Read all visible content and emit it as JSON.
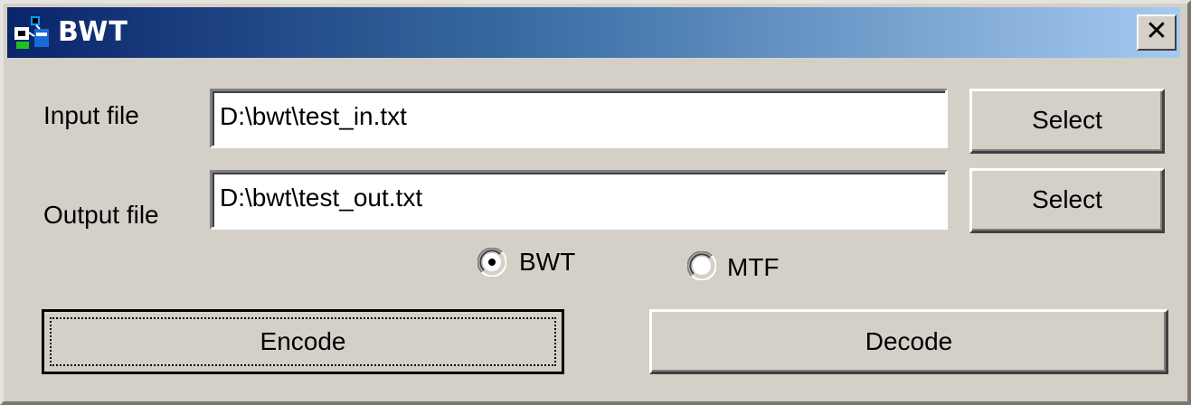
{
  "window": {
    "title": "BWT",
    "close_label": "✕"
  },
  "form": {
    "input_label": "Input file",
    "input_value": "D:\\bwt\\test_in.txt",
    "input_select_label": "Select",
    "output_label": "Output file",
    "output_value": "D:\\bwt\\test_out.txt",
    "output_select_label": "Select"
  },
  "mode": {
    "selected": "BWT",
    "options": [
      {
        "label": "BWT",
        "checked": true
      },
      {
        "label": "MTF",
        "checked": false
      }
    ]
  },
  "actions": {
    "encode_label": "Encode",
    "decode_label": "Decode"
  },
  "colors": {
    "face": "#d4d0c8",
    "title_start": "#0a246a",
    "title_end": "#a6caf0"
  }
}
